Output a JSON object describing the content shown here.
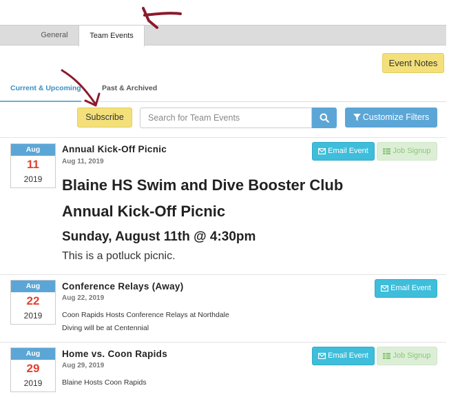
{
  "tabs": {
    "general": "General",
    "team_events": "Team Events"
  },
  "buttons": {
    "event_notes": "Event Notes",
    "subscribe": "Subscribe",
    "customize_filters": "Customize Filters"
  },
  "subtabs": {
    "current": "Current & Upcoming",
    "past": "Past & Archived"
  },
  "search": {
    "placeholder": "Search for Team Events"
  },
  "colors": {
    "accent_blue": "#5ba6d6",
    "yellow": "#f3e07a",
    "day_red": "#e0432f",
    "email_teal": "#3ebedb",
    "job_green": "#dcefd6",
    "arrow": "#8b1a2b"
  },
  "events": [
    {
      "month": "Aug",
      "day": "11",
      "year": "2019",
      "title": "Annual Kick-Off Picnic",
      "date": "Aug 11, 2019",
      "email_label": "Email Event",
      "job_label": "Job Signup",
      "big_title_line1": "Blaine HS Swim and Dive Booster Club",
      "big_title_line2": "Annual Kick-Off Picnic",
      "big_subtitle": "Sunday, August 11th @ 4:30pm",
      "big_desc": "This is a potluck picnic."
    },
    {
      "month": "Aug",
      "day": "22",
      "year": "2019",
      "title": "Conference Relays (Away)",
      "date": "Aug 22, 2019",
      "email_label": "Email Event",
      "desc_line1": "Coon Rapids Hosts Conference Relays at Northdale",
      "desc_line2": "Diving will be at Centennial"
    },
    {
      "month": "Aug",
      "day": "29",
      "year": "2019",
      "title": "Home vs. Coon Rapids",
      "date": "Aug 29, 2019",
      "email_label": "Email Event",
      "job_label": "Job Signup",
      "desc_line1": "Blaine Hosts Coon Rapids"
    }
  ]
}
